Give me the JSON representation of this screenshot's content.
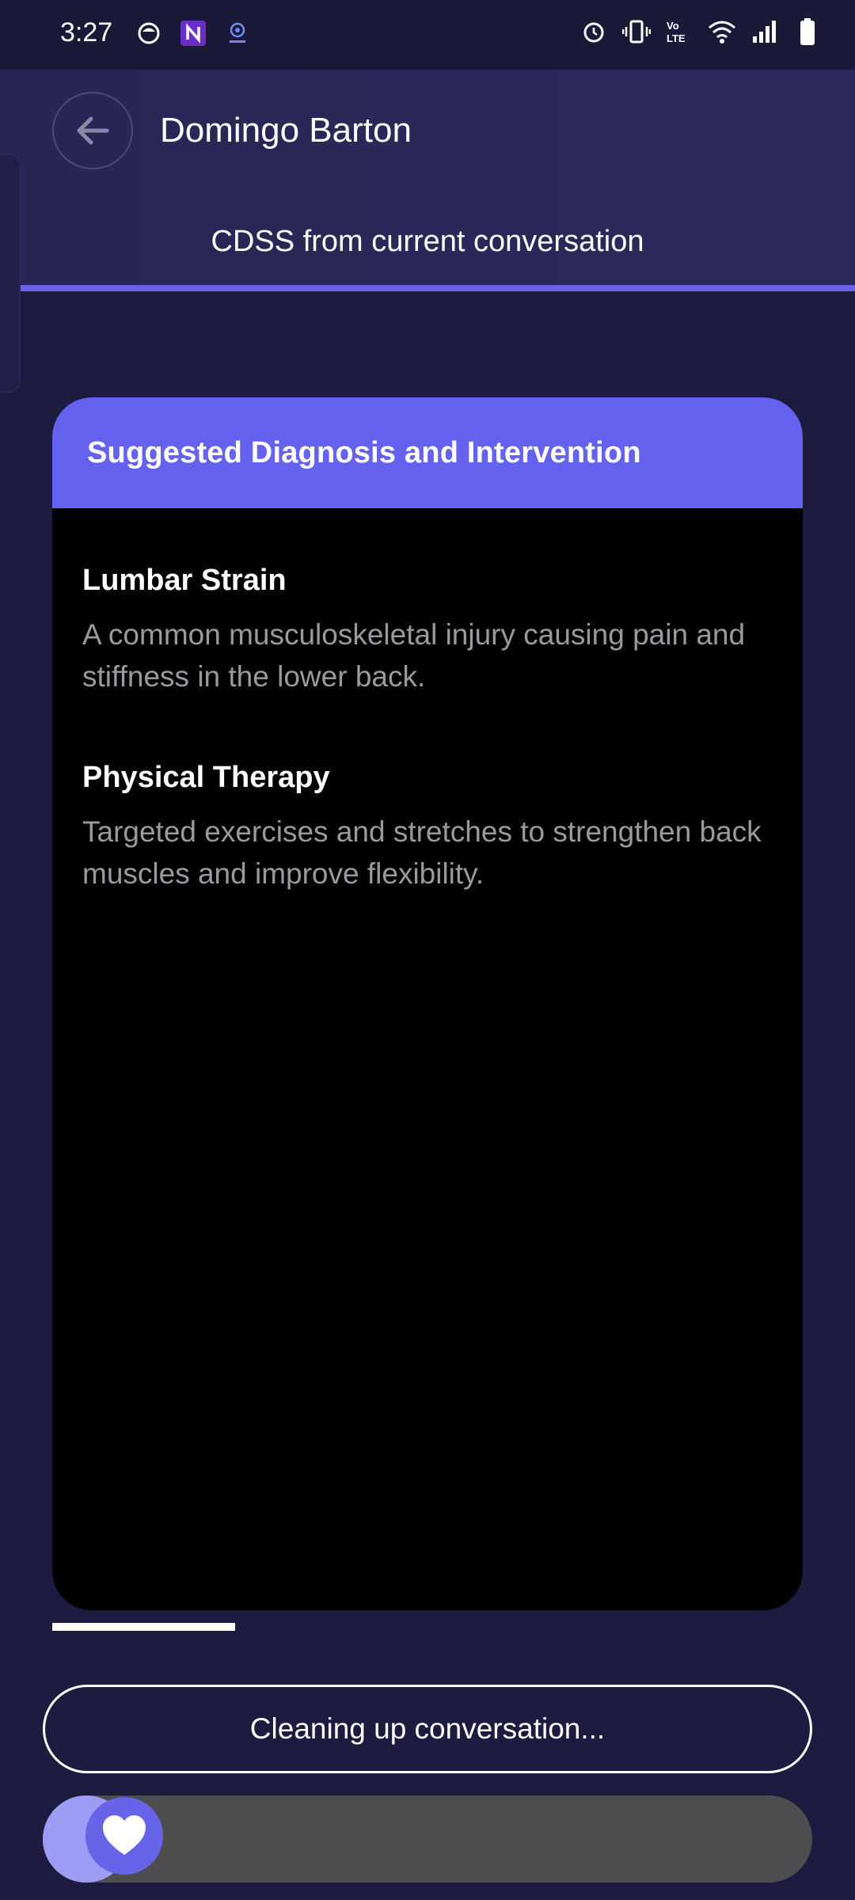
{
  "status_bar": {
    "time": "3:27",
    "left_icons": [
      "app-icon",
      "n-app-icon",
      "cast-icon"
    ],
    "right_icons": [
      "alarm-icon",
      "vibrate-icon",
      "volte-icon",
      "wifi-icon",
      "signal-icon",
      "battery-icon"
    ],
    "volte_label": "VoLTE"
  },
  "header": {
    "title": "Domingo Barton",
    "subtitle": "CDSS from current conversation",
    "back_icon": "arrow-left-icon"
  },
  "card": {
    "title": "Suggested Diagnosis and Intervention",
    "items": [
      {
        "title": "Lumbar Strain",
        "description": "A common musculoskeletal injury causing pain and stiffness in the lower back."
      },
      {
        "title": "Physical Therapy",
        "description": "Targeted exercises and stretches to strengthen back muscles and improve flexibility."
      }
    ]
  },
  "action": {
    "status_label": "Cleaning up conversation...",
    "slider_icon": "heart-icon"
  },
  "colors": {
    "background": "#1d1b3f",
    "header": "#2a2858",
    "accent": "#6462ee",
    "card": "#000000",
    "muted_text": "#9a9a9e",
    "track": "#4e4e50"
  }
}
